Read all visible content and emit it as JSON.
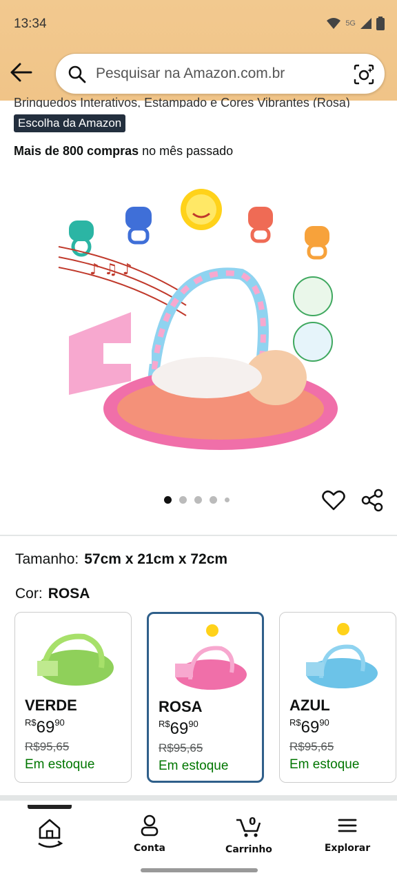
{
  "status": {
    "time": "13:34",
    "network": "5G"
  },
  "search": {
    "placeholder": "Pesquisar na Amazon.com.br"
  },
  "product": {
    "title_partial": "Brinquedos Interativos, Estampado e Cores Vibrantes (Rosa)",
    "badge": "Escolha da Amazon",
    "purchases_bold": "Mais de 800 compras",
    "purchases_rest": " no mês passado",
    "gallery": {
      "count": 5,
      "active_index": 0
    }
  },
  "options": {
    "size_label": "Tamanho:",
    "size_value": "57cm x 21cm x 72cm",
    "color_label": "Cor:",
    "color_value": "ROSA"
  },
  "variants": [
    {
      "name": "VERDE",
      "currency": "R$",
      "price_int": "69",
      "price_cents": "90",
      "old_price": "R$95,65",
      "stock": "Em estoque",
      "accent": "#7ec850",
      "selected": false
    },
    {
      "name": "ROSA",
      "currency": "R$",
      "price_int": "69",
      "price_cents": "90",
      "old_price": "R$95,65",
      "stock": "Em estoque",
      "accent": "#f39ac4",
      "selected": true
    },
    {
      "name": "AZUL",
      "currency": "R$",
      "price_int": "69",
      "price_cents": "90",
      "old_price": "R$95,65",
      "stock": "Em estoque",
      "accent": "#6cc3e8",
      "selected": false
    }
  ],
  "nav": {
    "home": "",
    "account": "Conta",
    "cart": "Carrinho",
    "cart_count": "0",
    "explore": "Explorar"
  },
  "colors": {
    "header": "#f2c98f",
    "badge_bg": "#232f3e",
    "stock_green": "#007600",
    "selected_border": "#2f5f8a"
  }
}
